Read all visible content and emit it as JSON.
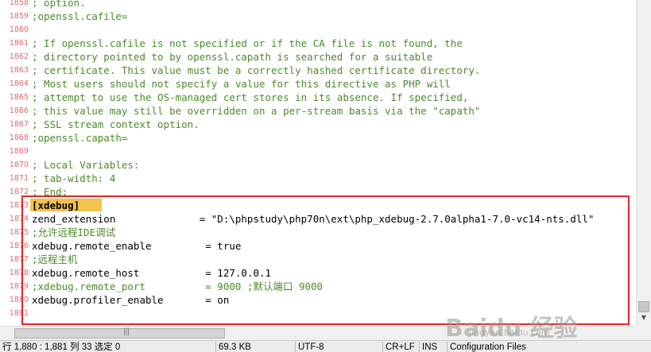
{
  "editor": {
    "lines": [
      {
        "no": "1858",
        "text": "; option.",
        "type": "comment"
      },
      {
        "no": "1859",
        "text": ";openssl.cafile=",
        "type": "comment"
      },
      {
        "no": "1860",
        "text": "",
        "type": "comment"
      },
      {
        "no": "1861",
        "text": "; If openssl.cafile is not specified or if the CA file is not found, the",
        "type": "comment"
      },
      {
        "no": "1862",
        "text": "; directory pointed to by openssl.capath is searched for a suitable",
        "type": "comment"
      },
      {
        "no": "1863",
        "text": "; certificate. This value must be a correctly hashed certificate directory.",
        "type": "comment"
      },
      {
        "no": "1864",
        "text": "; Most users should not specify a value for this directive as PHP will",
        "type": "comment"
      },
      {
        "no": "1865",
        "text": "; attempt to use the OS-managed cert stores in its absence. If specified,",
        "type": "comment"
      },
      {
        "no": "1866",
        "text": "; this value may still be overridden on a per-stream basis via the \"capath\"",
        "type": "comment"
      },
      {
        "no": "1867",
        "text": "; SSL stream context option.",
        "type": "comment"
      },
      {
        "no": "1868",
        "text": ";openssl.capath=",
        "type": "comment"
      },
      {
        "no": "1869",
        "text": "",
        "type": "comment"
      },
      {
        "no": "1870",
        "text": "; Local Variables:",
        "type": "comment"
      },
      {
        "no": "1871",
        "text": "; tab-width: 4",
        "type": "comment"
      },
      {
        "no": "1872",
        "text": "; End:",
        "type": "comment"
      },
      {
        "no": "1873",
        "text": "[xdebug]",
        "type": "section"
      },
      {
        "no": "1874",
        "text": "zend_extension              = \"D:\\phpstudy\\php70n\\ext\\php_xdebug-2.7.0alpha1-7.0-vc14-nts.dll\"",
        "type": "code"
      },
      {
        "no": "1875",
        "text": ";允许远程IDE调试",
        "type": "comment"
      },
      {
        "no": "1876",
        "text": "xdebug.remote_enable         = true",
        "type": "code"
      },
      {
        "no": "1877",
        "text": ";远程主机",
        "type": "comment"
      },
      {
        "no": "1878",
        "text": "xdebug.remote_host           = 127.0.0.1",
        "type": "code"
      },
      {
        "no": "1879",
        "text": ";xdebug.remote_port          = 9000 ;默认端口 9000",
        "type": "comment"
      },
      {
        "no": "1880",
        "text": "xdebug.profiler_enable       = on",
        "type": "code"
      },
      {
        "no": "1881",
        "text": "",
        "type": "code"
      }
    ]
  },
  "statusbar": {
    "position": "行 1,880 : 1,881  列 33  选定 0",
    "size": "69.3 KB",
    "encoding": "UTF-8",
    "eol": "CR+LF",
    "mode": "INS",
    "filetype": "Configuration Files"
  },
  "watermark": {
    "logo": "Baidu 经验",
    "url": "jingyan.baidu.com"
  },
  "colors": {
    "line_number": "#e06666",
    "comment": "#4a8a2a",
    "section_highlight": "#f2c14e",
    "frame": "#e0262b"
  }
}
